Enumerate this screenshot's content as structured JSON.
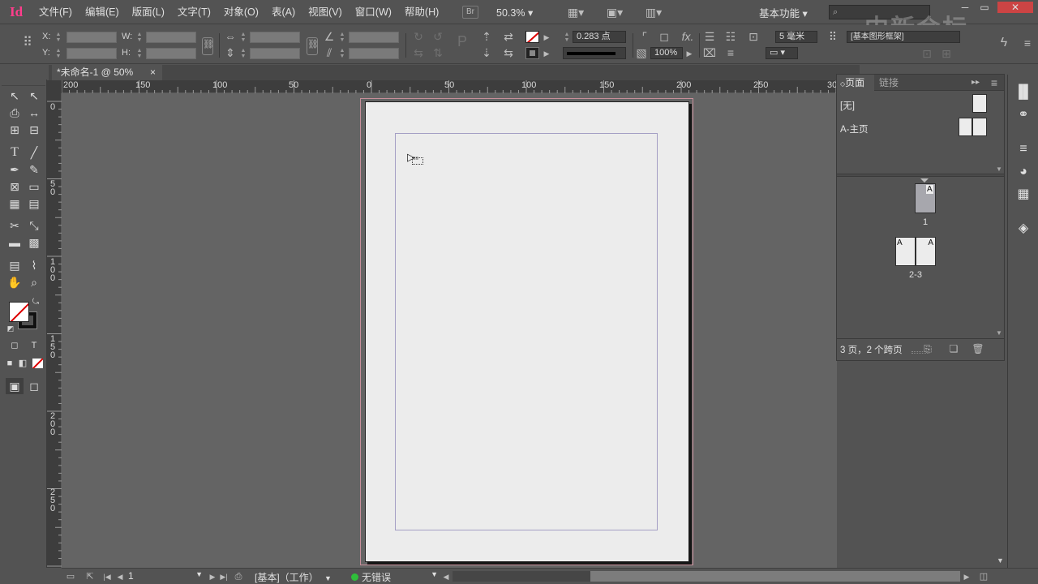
{
  "app": {
    "logo": "Id"
  },
  "menus": [
    "文件(F)",
    "编辑(E)",
    "版面(L)",
    "文字(T)",
    "对象(O)",
    "表(A)",
    "视图(V)",
    "窗口(W)",
    "帮助(H)"
  ],
  "menubar": {
    "bridge": "Br",
    "zoom": "50.3%",
    "workspace": "基本功能",
    "workspace_arrow": "▾",
    "search_icon": "⌕"
  },
  "window_controls": {
    "minimize": "─",
    "restore": "▭",
    "close": "✕"
  },
  "watermark": "中新会标",
  "control": {
    "x_label": "X:",
    "y_label": "Y:",
    "w_label": "W:",
    "h_label": "H:",
    "stroke_weight": "0.283 点",
    "opacity": "100%",
    "frame_spacing": "5 毫米",
    "style_dropdown": "[基本图形框架]"
  },
  "document_tab": {
    "title": "*未命名-1 @ 50%",
    "close": "×"
  },
  "ruler_h": [
    {
      "label": "200"
    },
    {
      "label": "150"
    },
    {
      "label": "100"
    },
    {
      "label": "50"
    },
    {
      "label": "0"
    },
    {
      "label": "50"
    },
    {
      "label": "100"
    },
    {
      "label": "150"
    },
    {
      "label": "200"
    },
    {
      "label": "250"
    },
    {
      "label": "30"
    }
  ],
  "ruler_v": [
    {
      "label": "0"
    },
    {
      "label": "5 0"
    },
    {
      "label": "1 0 0"
    },
    {
      "label": "1 5 0"
    },
    {
      "label": "2 0 0"
    },
    {
      "label": "2 5 0"
    }
  ],
  "statusbar": {
    "page_number": "1",
    "master_info": "[基本]（工作）",
    "preflight": "无错误",
    "preflight_color": "#2fbf3a"
  },
  "pages_panel": {
    "tab_pages": "页面",
    "tab_links": "链接",
    "master_none": "[无]",
    "master_a": "A-主页",
    "page1_label": "1",
    "page1_master": "A",
    "spread_label": "2-3",
    "spread_left_master": "A",
    "spread_right_master": "A",
    "summary": "3 页，2 个跨页"
  },
  "colors": {
    "accent_logo": "#ff3d8c",
    "bleed": "#c88f9b",
    "margin": "#a49fc4"
  }
}
